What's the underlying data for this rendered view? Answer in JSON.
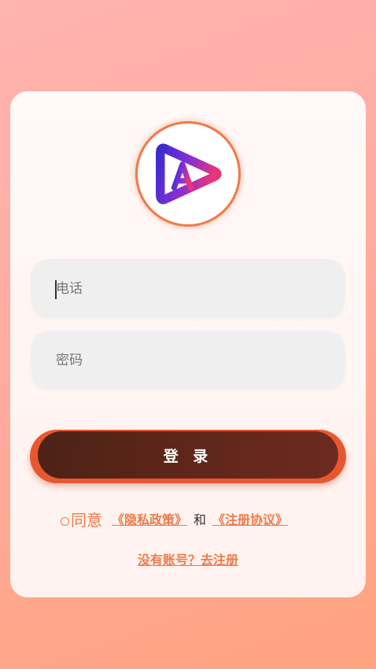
{
  "login_form": {
    "phone_placeholder": "电话",
    "password_placeholder": "密码",
    "login_label": "登 录"
  },
  "agreement": {
    "agree_label": "同意",
    "privacy_link": "《隐私政策》",
    "and_label": "和",
    "terms_link": "《注册协议》"
  },
  "register_link": "没有账号？去注册",
  "icons": {
    "logo": "play-triangle-letter-a-logo",
    "radio": "radio-unchecked-icon"
  },
  "colors": {
    "accent": "#ef7a4a",
    "button_dark": "#5f261b",
    "button_border": "#e9572f",
    "logo_purple": "#7a2fd6",
    "logo_pink": "#e0357a"
  }
}
